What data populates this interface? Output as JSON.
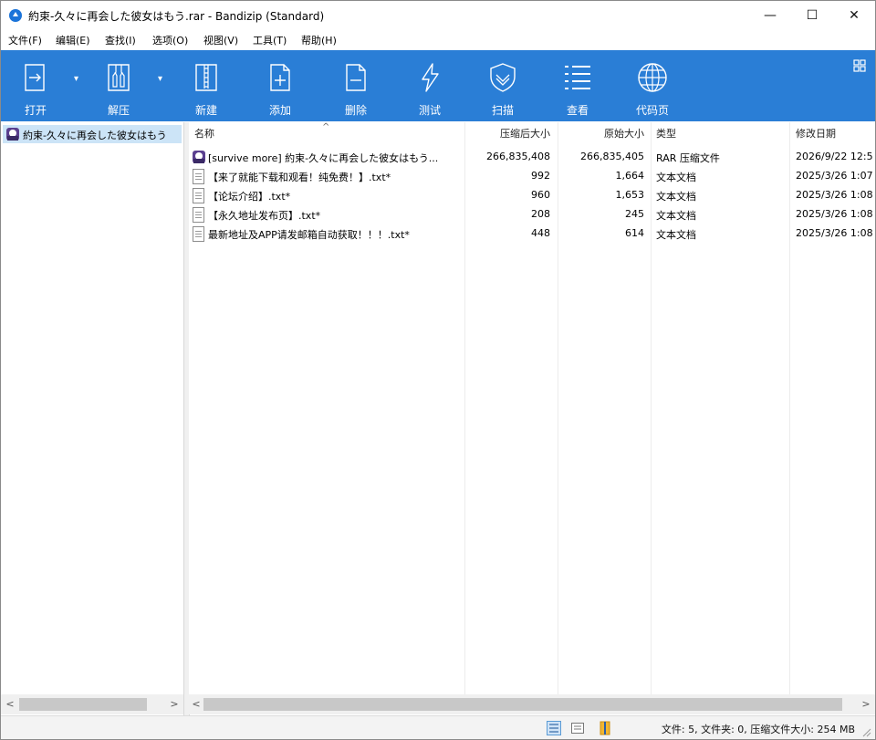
{
  "window": {
    "title": "約束-久々に再会した彼女はもう.rar - Bandizip (Standard)",
    "controls": {
      "minimize": "—",
      "maximize": "☐",
      "close": "✕"
    }
  },
  "menu": [
    "文件(F)",
    "编辑(E)",
    "查找(I)",
    "选项(O)",
    "视图(V)",
    "工具(T)",
    "帮助(H)"
  ],
  "toolbar": {
    "open": "打开",
    "extract": "解压",
    "new": "新建",
    "add": "添加",
    "delete": "删除",
    "test": "测试",
    "scan": "扫描",
    "view": "查看",
    "codepage": "代码页",
    "colors": {
      "background": "#2a7ed6",
      "foreground": "#ffffff"
    }
  },
  "tree": {
    "root_label": "約束-久々に再会した彼女はもう"
  },
  "columns": {
    "name": "名称",
    "packed": "压缩后大小",
    "size": "原始大小",
    "type": "类型",
    "modified": "修改日期"
  },
  "files": [
    {
      "name": "[survive more] 約束-久々に再会した彼女はもう...",
      "packed": "266,835,408",
      "size": "266,835,405",
      "type": "RAR 压缩文件",
      "modified": "2026/9/22 12:5",
      "icon": "rar-icon"
    },
    {
      "name": "【来了就能下载和观看！纯免费！】.txt*",
      "packed": "992",
      "size": "1,664",
      "type": "文本文档",
      "modified": "2025/3/26 1:07",
      "icon": "text-file-icon"
    },
    {
      "name": "【论坛介绍】.txt*",
      "packed": "960",
      "size": "1,653",
      "type": "文本文档",
      "modified": "2025/3/26 1:08",
      "icon": "text-file-icon"
    },
    {
      "name": "【永久地址发布页】.txt*",
      "packed": "208",
      "size": "245",
      "type": "文本文档",
      "modified": "2025/3/26 1:08",
      "icon": "text-file-icon"
    },
    {
      "name": "最新地址及APP请发邮箱自动获取！！！.txt*",
      "packed": "448",
      "size": "614",
      "type": "文本文档",
      "modified": "2025/3/26 1:08",
      "icon": "text-file-icon"
    }
  ],
  "status": {
    "text": "文件: 5, 文件夹: 0, 压缩文件大小: 254 MB"
  }
}
